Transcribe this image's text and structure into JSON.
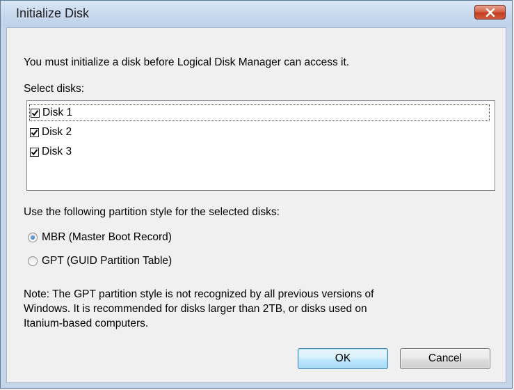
{
  "window": {
    "title": "Initialize Disk",
    "close_icon": "close-x-icon",
    "close_color": "#c94a2e"
  },
  "intro_text": "You must initialize a disk before Logical Disk Manager can access it.",
  "select_disks_label": "Select disks:",
  "disks": [
    {
      "label": "Disk 1",
      "checked": true
    },
    {
      "label": "Disk 2",
      "checked": true
    },
    {
      "label": "Disk 3",
      "checked": true
    }
  ],
  "partition_style_label": "Use the following partition style for the selected disks:",
  "partition_styles": [
    {
      "label": "MBR (Master Boot Record)",
      "selected": true
    },
    {
      "label": "GPT (GUID Partition Table)",
      "selected": false
    }
  ],
  "note_lines": [
    "Note: The GPT partition style is not recognized by all previous versions of",
    "Windows. It is recommended for disks larger than 2TB, or disks used on",
    "Itanium-based computers."
  ],
  "buttons": {
    "ok": "OK",
    "cancel": "Cancel"
  }
}
